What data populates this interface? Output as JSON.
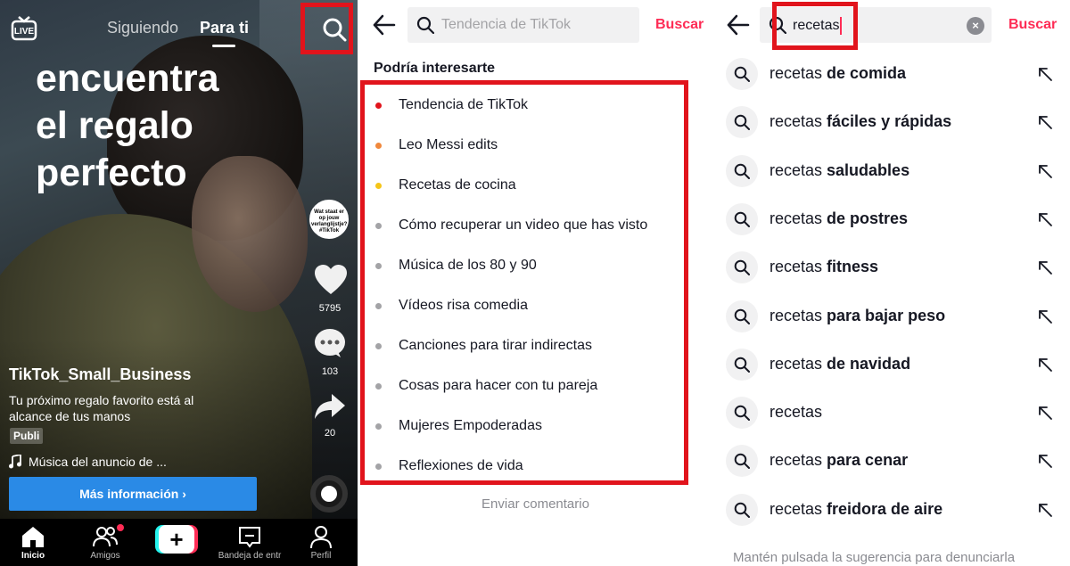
{
  "feed": {
    "live_label": "LIVE",
    "tabs": [
      "Siguiendo",
      "Para ti"
    ],
    "active_tab": "Para ti",
    "headline": [
      "encuentra",
      "el regalo",
      "perfecto"
    ],
    "avatar_text": "Wat staat er op jouw verlanglijstje? #TikTok",
    "likes": "5795",
    "comments": "103",
    "shares": "20",
    "username": "TikTok_Small_Business",
    "caption": "Tu próximo regalo favorito está al alcance de tus manos",
    "ad_badge": "Publi",
    "music": "Música del anuncio de ...",
    "cta": "Más información ›",
    "nav": [
      {
        "label": "Inicio",
        "icon": "home-icon"
      },
      {
        "label": "Amigos",
        "icon": "friends-icon"
      },
      {
        "label": "",
        "icon": "create-icon"
      },
      {
        "label": "Bandeja de entr",
        "icon": "inbox-icon"
      },
      {
        "label": "Perfil",
        "icon": "profile-icon"
      }
    ]
  },
  "suggestions": {
    "placeholder": "Tendencia de TikTok",
    "search_button": "Buscar",
    "section_title": "Podría interesarte",
    "items": [
      {
        "text": "Tendencia de TikTok",
        "dot": "#e1141c"
      },
      {
        "text": "Leo Messi edits",
        "dot": "#f0883c"
      },
      {
        "text": "Recetas de cocina",
        "dot": "#f5c518"
      },
      {
        "text": "Cómo recuperar un video que has visto",
        "dot": "#a3a3a6"
      },
      {
        "text": "Música de los 80 y 90",
        "dot": "#a3a3a6"
      },
      {
        "text": "Vídeos risa comedia",
        "dot": "#a3a3a6"
      },
      {
        "text": "Canciones para tirar indirectas",
        "dot": "#a3a3a6"
      },
      {
        "text": "Cosas para hacer con tu pareja",
        "dot": "#a3a3a6"
      },
      {
        "text": "Mujeres Empoderadas",
        "dot": "#a3a3a6"
      },
      {
        "text": "Reflexiones de vida",
        "dot": "#a3a3a6"
      }
    ],
    "feedback": "Enviar comentario"
  },
  "autocomplete": {
    "query": "recetas",
    "search_button": "Buscar",
    "items": [
      {
        "base": "recetas",
        "suffix": " de comida"
      },
      {
        "base": "recetas",
        "suffix": " fáciles y rápidas"
      },
      {
        "base": "recetas",
        "suffix": " saludables"
      },
      {
        "base": "recetas",
        "suffix": " de postres"
      },
      {
        "base": "recetas",
        "suffix": " fitness"
      },
      {
        "base": "recetas",
        "suffix": " para bajar peso"
      },
      {
        "base": "recetas",
        "suffix": " de navidad"
      },
      {
        "base": "recetas",
        "suffix": ""
      },
      {
        "base": "recetas",
        "suffix": " para cenar"
      },
      {
        "base": "recetas",
        "suffix": " freidora de aire"
      }
    ],
    "hint": "Mantén pulsada la sugerencia para denunciarla"
  },
  "colors": {
    "highlight": "#e1141c",
    "brand": "#fe2c55",
    "cta": "#2a8ae6"
  }
}
